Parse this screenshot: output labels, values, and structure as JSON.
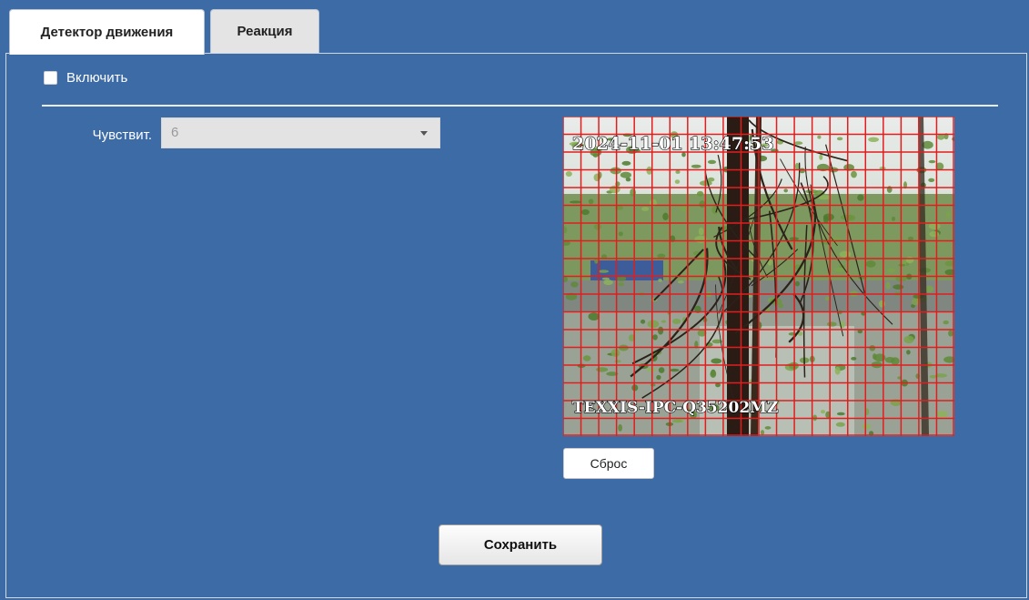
{
  "tabs": [
    {
      "label": "Детектор движения",
      "active": true
    },
    {
      "label": "Реакция",
      "active": false
    }
  ],
  "enable": {
    "label": "Включить",
    "checked": false
  },
  "sensitivity": {
    "label": "Чувствит.",
    "value": "6"
  },
  "preview": {
    "timestamp": "2024-11-01 13:47:53",
    "camera_name": "TEXXIS-IPC-Q35202MZ",
    "grid_color": "#e01e1e",
    "grid_columns": 22,
    "grid_rows": 18
  },
  "buttons": {
    "reset": "Сброс",
    "save": "Сохранить"
  },
  "colors": {
    "background": "#3c6ba6",
    "active_tab": "#ffffff",
    "inactive_tab": "#e4e4e4"
  }
}
